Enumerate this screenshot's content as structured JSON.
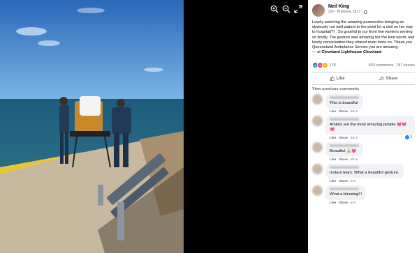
{
  "viewer": {
    "zoom_in_icon": "zoom-in-icon",
    "zoom_out_icon": "zoom-out-icon",
    "fullscreen_icon": "fullscreen-icon"
  },
  "post": {
    "author": "Neil King",
    "meta": "22h · Brisbane, QLD ·",
    "body": "Lovely watching the amazing paramedics bringing an obviously not well patient to the point for a visit on her way to hospital(?) . So grateful to our front line workers serving so kindly. The gesture was amazing but the kind words and lovely conversation they shared even more so. Thank you Queensland Ambulance Service you are amazing .",
    "checkin_prefix": "— at ",
    "checkin_place": "Cleveland Lighthouse Cleveland",
    "reaction_count": "17K",
    "comments_count": "553 comments",
    "shares_count": "787 shares",
    "like_label": "Like",
    "share_label": "Share",
    "view_previous": "View previous comments"
  },
  "comments": [
    {
      "text": "This is beautiful",
      "like": "Like",
      "reply": "Share",
      "time": "52 m"
    },
    {
      "text": "Ambos are the most amazing people 💓💓💓",
      "like": "Like",
      "reply": "Share",
      "time": "46 m",
      "replies": "3"
    },
    {
      "text": "Beautiful 🙏💓",
      "like": "Like",
      "reply": "Share",
      "time": "26 m"
    },
    {
      "text": "Instant tears. What a beautiful gesture.",
      "like": "Like",
      "reply": "Share",
      "time": "8 m"
    },
    {
      "text": "What a blessing!!!",
      "like": "Like",
      "reply": "Share",
      "time": "8 m"
    }
  ],
  "colors": {
    "accent": "#1877f2",
    "love": "#f33e58",
    "care": "#f7b125"
  }
}
